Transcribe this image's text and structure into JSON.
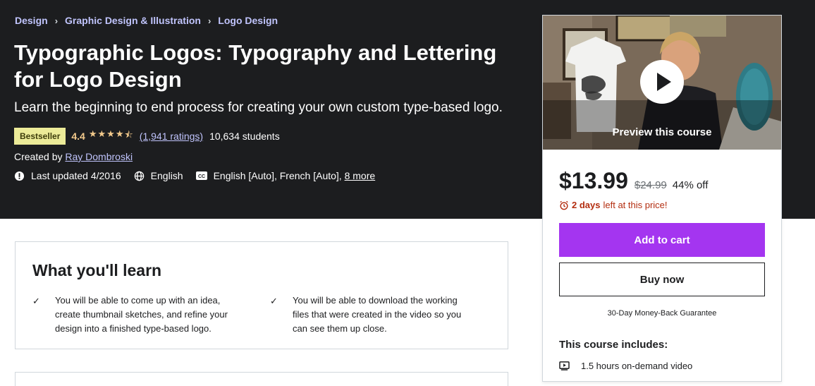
{
  "breadcrumb": [
    "Design",
    "Graphic Design & Illustration",
    "Logo Design"
  ],
  "course": {
    "title": "Typographic Logos: Typography and Lettering for Logo Design",
    "subtitle": "Learn the beginning to end process for creating your own custom type-based logo.",
    "badge": "Bestseller",
    "rating": "4.4",
    "rating_value": 4.4,
    "ratings_count": "(1,941 ratings)",
    "students": "10,634 students",
    "created_by_prefix": "Created by",
    "instructor": "Ray Dombroski",
    "last_updated": "Last updated 4/2016",
    "language": "English",
    "captions": "English [Auto], French [Auto],",
    "more_captions": "8 more"
  },
  "learn": {
    "title": "What you'll learn",
    "items": [
      "You will be able to come up with an idea, create thumbnail sketches, and refine your design into a finished type-based logo.",
      "You will be able to download the working files that were created in the video so you can see them up close."
    ]
  },
  "sidebar": {
    "preview_label": "Preview this course",
    "price": "$13.99",
    "original_price": "$24.99",
    "discount": "44% off",
    "deadline_bold": "2 days",
    "deadline_rest": "left at this price!",
    "add_to_cart": "Add to cart",
    "buy_now": "Buy now",
    "guarantee": "30-Day Money-Back Guarantee",
    "includes_title": "This course includes:",
    "includes": [
      "1.5 hours on-demand video"
    ]
  },
  "colors": {
    "hero_bg": "#1c1d1f",
    "accent": "#a435f0",
    "link": "#c0c4fc",
    "star": "#f3ca8c",
    "badge": "#eceb98",
    "deadline": "#b32d0f"
  }
}
